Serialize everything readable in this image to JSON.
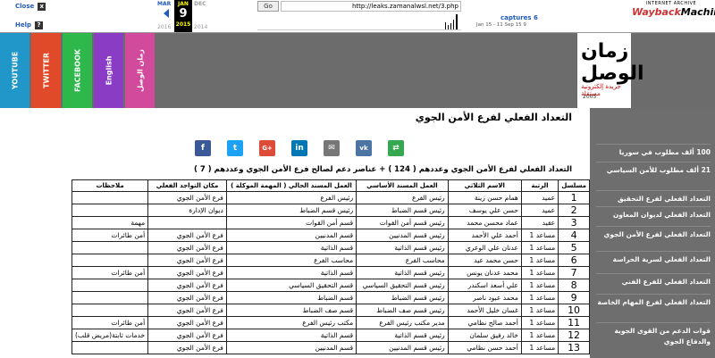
{
  "wayback": {
    "close_label": "Close",
    "close_symbol": "x",
    "help_label": "Help",
    "help_symbol": "?",
    "prev_month": "MAR",
    "cur_month": "JAN",
    "next_month": "DEC",
    "cur_day": "9",
    "prev_year": "2016",
    "cur_year": "2015",
    "next_year": "2014",
    "go_label": "Go",
    "url": "http://leaks.zamanalwsl.net/3.php",
    "captures": "captures 6",
    "captures_range": "Jan 15 - 11 Sep 15 9",
    "ia_text": "INTERNET ARCHIVE",
    "ia_way": "Wayback",
    "ia_machine": "Machine"
  },
  "tabs": [
    {
      "label": "YOUTUBE",
      "color": "#2196c9"
    },
    {
      "label": "TWITTER",
      "color": "#e04a2a"
    },
    {
      "label": "FACEBOOK",
      "color": "#2eb84c"
    },
    {
      "label": "English",
      "color": "#8b3cc4"
    },
    {
      "label": "زمان الوصل",
      "color": "#d24a9c"
    }
  ],
  "logo": {
    "text": "زمان الوصل",
    "sub": "جريدة إلكترونية مستقلة",
    "year": "2005"
  },
  "sidebar": [
    "100 ألف مطلوب في سوريا",
    "21 ألف مطلوب للأمن السياسي",
    "التعداد الفعلي لفرع التحقيق",
    "التعداد الفعلي لديوان المعاون",
    "التعداد الفعلي لفرع الأمن الجوي",
    "التعداد الفعلي لسرية الحراسة",
    "التعداد الفعلي للفرع الفني",
    "التعداد الفعلي لفرع المهام الخاصة",
    "قوات الدعم من القوى الجوية والدفاع الجوي"
  ],
  "page_title": "التعداد الفعلي لفرع الأمن الجوي",
  "share": [
    {
      "icon": "f",
      "color": "#3b5998"
    },
    {
      "icon": "t",
      "color": "#1da1f2"
    },
    {
      "icon": "G+",
      "color": "#dd4b39"
    },
    {
      "icon": "in",
      "color": "#0077b5"
    },
    {
      "icon": "✉",
      "color": "#777777"
    },
    {
      "icon": "vk",
      "color": "#4c75a3"
    },
    {
      "icon": "⇄",
      "color": "#36a852"
    }
  ],
  "description": "التعداد الفعلي لفرع الأمن الجوي وعددهم ( 124 ) + عناصر دعم لصالح فرع الأمن الجوي وعددهم ( 7 )",
  "table": {
    "headers": [
      "مسلسل",
      "الرتبة",
      "الاسم الثلاثي",
      "العمل المسند الأساسي",
      "العمل المسند الحالي ( المهمة الموكلة )",
      "مكان التواجد الفعلي",
      "ملاحظات"
    ],
    "rows": [
      [
        "1",
        "عميد",
        "همام حسن زينة",
        "رئيس الفرع",
        "رئيس الفرع",
        "فرع الأمن الجوي",
        ""
      ],
      [
        "2",
        "عميد",
        "حسن علي يوسف",
        "رئيس قسم الضباط",
        "رئيس قسم الضباط",
        "ديوان الإدارة",
        ""
      ],
      [
        "3",
        "عقيد",
        "عماد محسن محمد",
        "رئيس قسم أمن القوات",
        "قسم أمن القوات",
        "",
        "مهمة"
      ],
      [
        "4",
        "مساعد 1",
        "أحمد علي الأحمد",
        "رئيس قسم المدنيين",
        "قسم المدنيين",
        "فرع الأمن الجوي",
        "أمن طائرات"
      ],
      [
        "5",
        "مساعد 1",
        "عدنان علي الوعري",
        "رئيس قسم الذاتية",
        "قسم الذاتية",
        "فرع الأمن الجوي",
        ""
      ],
      [
        "6",
        "مساعد 1",
        "حسن محمد عيد",
        "محاسب الفرع",
        "محاسب الفرع",
        "فرع الأمن الجوي",
        ""
      ],
      [
        "7",
        "مساعد 1",
        "محمد عدنان يونس",
        "رئيس قسم الذاتية",
        "قسم الذاتية",
        "فرع الأمن الجوي",
        "أمن طائرات"
      ],
      [
        "8",
        "مساعد 1",
        "علي أسعد اسكندر",
        "رئيس قسم التحقيق السياسي",
        "قسم التحقيق السياسي",
        "فرع الأمن الجوي",
        ""
      ],
      [
        "9",
        "مساعد 1",
        "محمد عبود ناصر",
        "رئيس قسم الضباط",
        "قسم الضباط",
        "فرع الأمن الجوي",
        ""
      ],
      [
        "10",
        "مساعد 1",
        "غسان خليل الأحمد",
        "رئيس قسم صف الضباط",
        "قسم صف الضباط",
        "فرع الأمن الجوي",
        ""
      ],
      [
        "11",
        "مساعد 1",
        "أحمد صالح نظامي",
        "مدير مكتب رئيس الفرع",
        "مكتب رئيس الفرع",
        "فرع الأمن الجوي",
        "أمن طائرات"
      ],
      [
        "12",
        "مساعد 1",
        "خالد رفيق سلمان",
        "رئيس قسم الذاتية",
        "قسم الذاتية",
        "فرع الأمن الجوي",
        "خدمات ثابتة(مريض قلب)"
      ],
      [
        "13",
        "مساعد 1",
        "أحمد حسن نظامي",
        "رئيس قسم المدنيين",
        "قسم المدنيين",
        "فرع الأمن الجوي",
        ""
      ]
    ]
  }
}
